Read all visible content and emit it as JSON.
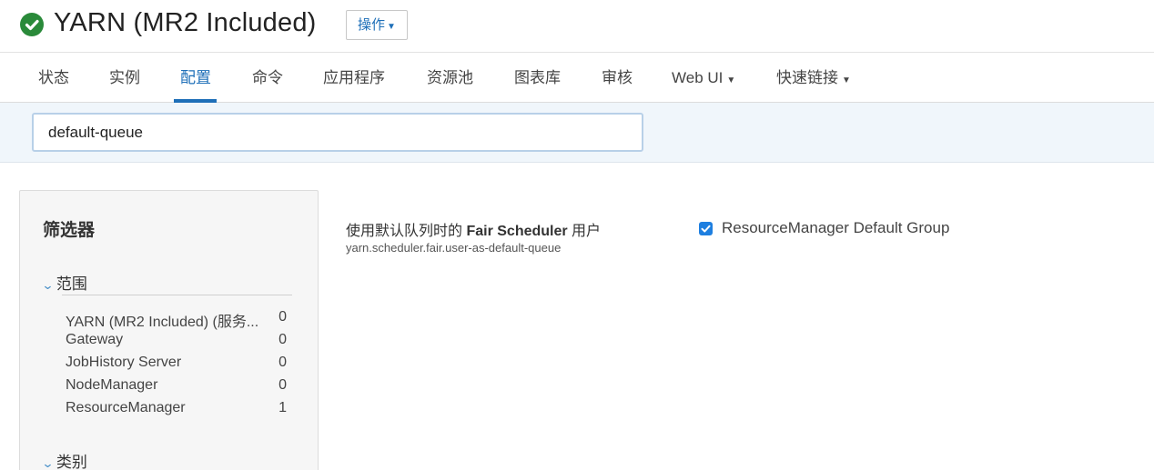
{
  "header": {
    "title": "YARN (MR2 Included)",
    "status_icon": "check-circle-icon",
    "status_color": "#2a8a3a",
    "actions_label": "操作"
  },
  "tabs": [
    {
      "label": "状态",
      "active": false
    },
    {
      "label": "实例",
      "active": false
    },
    {
      "label": "配置",
      "active": true
    },
    {
      "label": "命令",
      "active": false
    },
    {
      "label": "应用程序",
      "active": false
    },
    {
      "label": "资源池",
      "active": false
    },
    {
      "label": "图表库",
      "active": false
    },
    {
      "label": "审核",
      "active": false
    },
    {
      "label": "Web UI",
      "active": false,
      "dropdown": true
    },
    {
      "label": "快速链接",
      "active": false,
      "dropdown": true
    }
  ],
  "search": {
    "value": "default-queue"
  },
  "filters": {
    "title": "筛选器",
    "scope": {
      "label": "范围",
      "items": [
        {
          "name": "YARN (MR2 Included) (服务...",
          "count": "0"
        },
        {
          "name": "Gateway",
          "count": "0"
        },
        {
          "name": "JobHistory Server",
          "count": "0"
        },
        {
          "name": "NodeManager",
          "count": "0"
        },
        {
          "name": "ResourceManager",
          "count": "1"
        }
      ]
    },
    "category": {
      "label": "类别"
    }
  },
  "property": {
    "title_prefix": "使用默认队列时的 ",
    "title_bold": "Fair Scheduler",
    "title_suffix": " 用户",
    "key": "yarn.scheduler.fair.user-as-default-queue",
    "checked": true,
    "value_label": "ResourceManager Default Group"
  },
  "colors": {
    "accent": "#1e6fb8",
    "checkbox": "#1e7fe0"
  }
}
